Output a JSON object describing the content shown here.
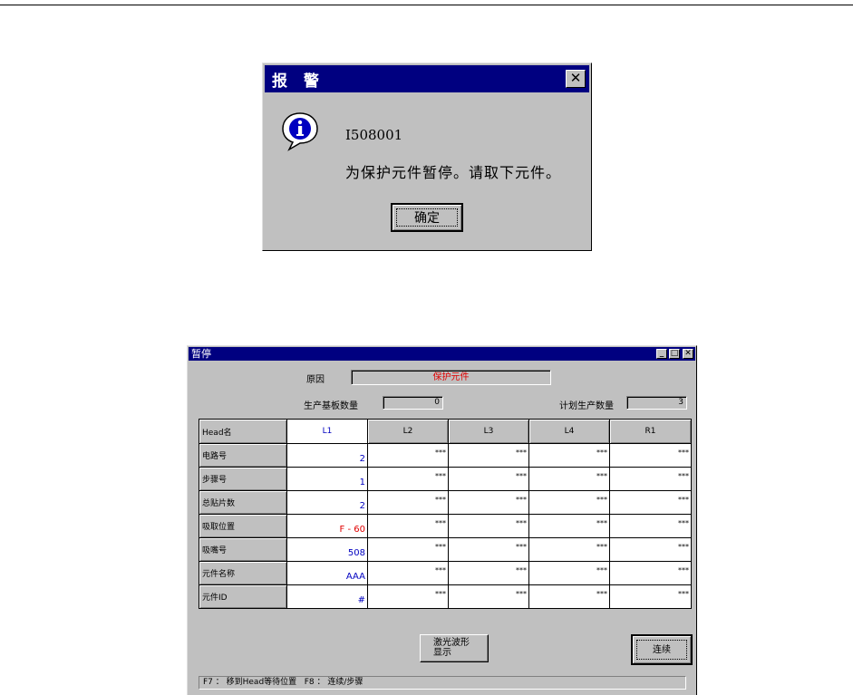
{
  "dialog1": {
    "title": "报 警",
    "close_symbol": "✕",
    "icon": "info-icon",
    "code": "I508001",
    "message": "为保护元件暂停。请取下元件。",
    "ok_label": "确定"
  },
  "dialog2": {
    "title": "暂停",
    "window_buttons": {
      "minimize": "_",
      "maximize": "□",
      "close": "✕"
    },
    "reason_label": "原因",
    "reason_value": "保护元件",
    "boards_label": "生产基板数量",
    "boards_value": "0",
    "planned_label": "计划生产数量",
    "planned_value": "3",
    "table": {
      "corner": "Head名",
      "columns": [
        "L1",
        "L2",
        "L3",
        "L4",
        "R1"
      ],
      "rows": [
        {
          "label": "电路号",
          "values": [
            "2",
            "***",
            "***",
            "***",
            "***"
          ]
        },
        {
          "label": "步骤号",
          "values": [
            "1",
            "***",
            "***",
            "***",
            "***"
          ]
        },
        {
          "label": "总贴片数",
          "values": [
            "2",
            "***",
            "***",
            "***",
            "***"
          ]
        },
        {
          "label": "吸取位置",
          "values": [
            "F - 60",
            "***",
            "***",
            "***",
            "***"
          ]
        },
        {
          "label": "吸嘴号",
          "values": [
            "508",
            "***",
            "***",
            "***",
            "***"
          ]
        },
        {
          "label": "元件名称",
          "values": [
            "AAA",
            "***",
            "***",
            "***",
            "***"
          ]
        },
        {
          "label": "元件ID",
          "values": [
            "#",
            "***",
            "***",
            "***",
            "***"
          ]
        }
      ]
    },
    "laser_button": {
      "line1": "激光波形",
      "line2": "显示"
    },
    "continue_label": "连续",
    "status_bar": "F7 ： 移到Head等待位置   F8 ： 连续/步骤"
  },
  "colors": {
    "titlebar": "#000080",
    "face": "#c0c0c0",
    "highlight_text": "#e00000",
    "value_text": "#0000c0"
  }
}
